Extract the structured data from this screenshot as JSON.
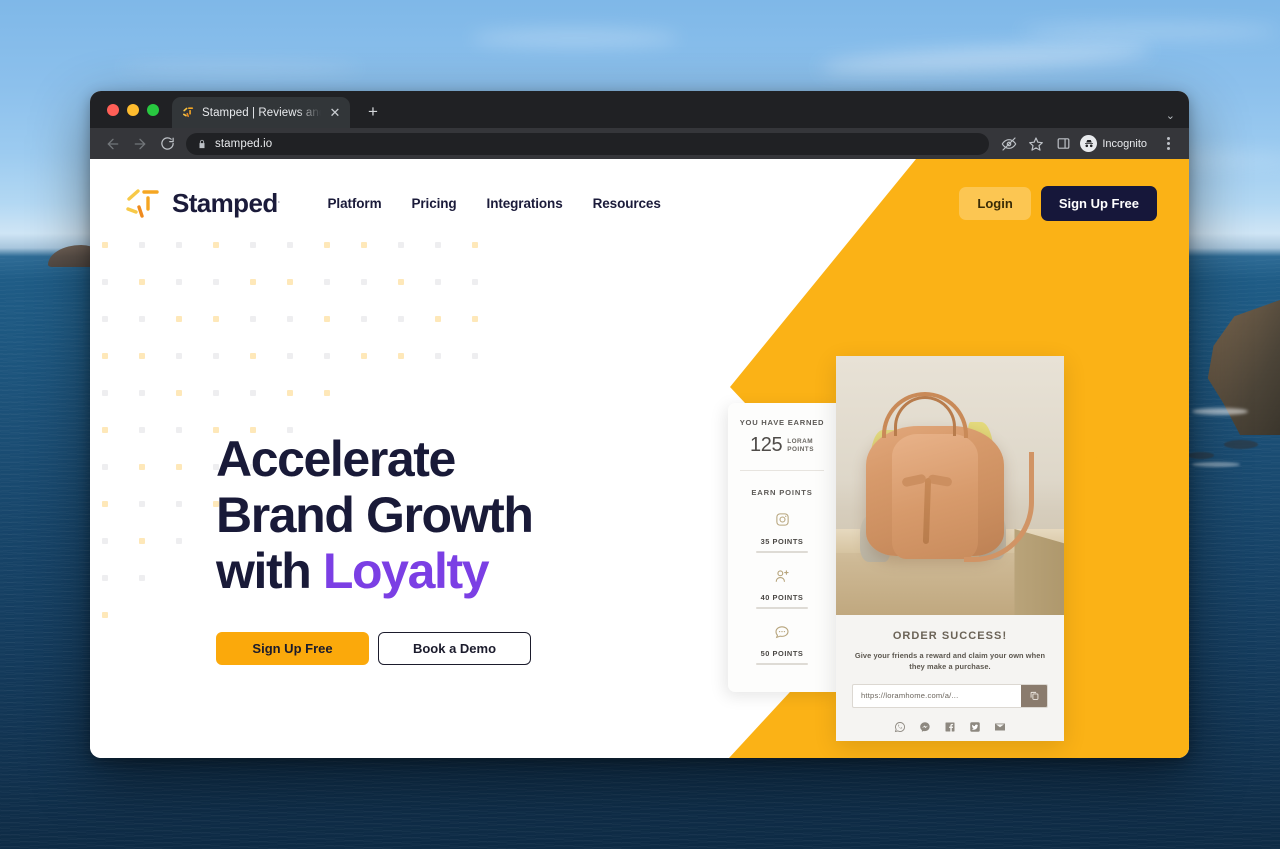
{
  "browser": {
    "tab": {
      "title": "Stamped | Reviews and Loyalty",
      "favicon": "stamped-starburst-icon",
      "close": "✕"
    },
    "new_tab_label": "+",
    "window_chevron": "⌄",
    "omnibox": {
      "url": "stamped.io",
      "lock_icon": "lock-icon"
    },
    "back_icon": "←",
    "forward_icon": "→",
    "reload_icon": "↻",
    "profile": {
      "label": "Incognito",
      "icon": "incognito-icon"
    },
    "toolbar_icons": [
      "eye-slash-icon",
      "star-icon",
      "side-panel-icon"
    ],
    "menu_icon": "kebab-menu-icon"
  },
  "site": {
    "brand": {
      "name": "Stamped",
      "trademark": ".",
      "logo": "stamped-starburst-logo"
    },
    "nav": [
      {
        "label": "Platform"
      },
      {
        "label": "Pricing"
      },
      {
        "label": "Integrations"
      },
      {
        "label": "Resources"
      }
    ],
    "header_actions": {
      "login": "Login",
      "signup": "Sign Up Free"
    },
    "hero": {
      "line1": "Accelerate",
      "line2": "Brand Growth",
      "line3_prefix": "with ",
      "line3_accent": "Loyalty",
      "cta_primary": "Sign Up Free",
      "cta_secondary": "Book a Demo"
    },
    "points_widget": {
      "title": "YOU HAVE EARNED",
      "amount": "125",
      "unit_line1": "LORAM",
      "unit_line2": "POINTS",
      "earn_label": "EARN POINTS",
      "actions": [
        {
          "icon": "instagram-icon",
          "points": "35 POINTS"
        },
        {
          "icon": "person-add-icon",
          "points": "40 POINTS"
        },
        {
          "icon": "chat-bubble-icon",
          "points": "50 POINTS"
        }
      ]
    },
    "product_card": {
      "image_alt": "tan-leather-bucket-bag",
      "title": "ORDER SUCCESS!",
      "subtitle": "Give your friends a reward and claim your own when they make a purchase.",
      "share_url": "https://loramhome.com/a/...",
      "copy_icon": "copy-icon",
      "socials": [
        {
          "icon": "whatsapp-icon"
        },
        {
          "icon": "messenger-icon"
        },
        {
          "icon": "facebook-icon"
        },
        {
          "icon": "twitter-icon"
        },
        {
          "icon": "email-icon"
        }
      ]
    }
  },
  "colors": {
    "orange": "#FBB216",
    "cta_orange": "#FBA90B",
    "navy": "#16173A",
    "purple": "#7B3FE4",
    "gold": "#B7A57D"
  }
}
